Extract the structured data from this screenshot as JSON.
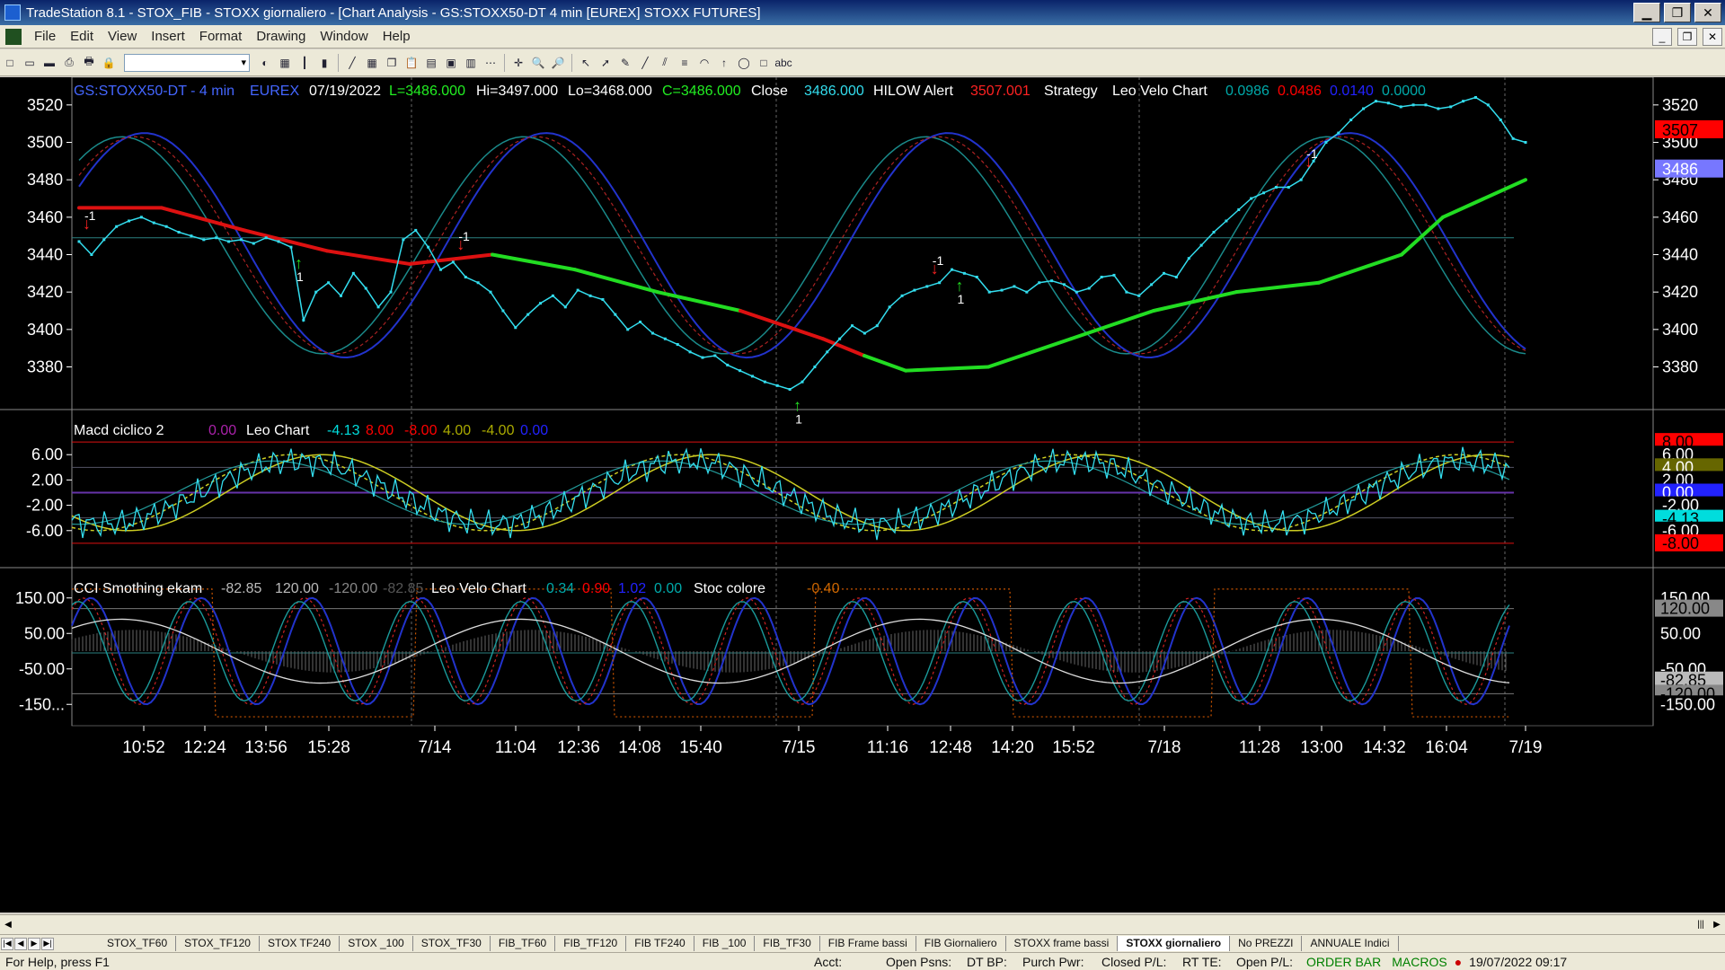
{
  "window": {
    "title": "TradeStation 8.1 - STOX_FIB - STOXX giornaliero - [Chart Analysis - GS:STOXX50-DT  4 min  [EUREX] STOXX FUTURES]",
    "minimize": "▁",
    "restore": "❐",
    "close": "✕"
  },
  "menu": {
    "items": [
      "File",
      "Edit",
      "View",
      "Insert",
      "Format",
      "Drawing",
      "Window",
      "Help"
    ],
    "child_min": "_",
    "child_restore": "❐",
    "child_close": "✕"
  },
  "toolbar": {
    "icons": [
      "new-icon",
      "open-icon",
      "save-icon",
      "print-icon",
      "preview-icon",
      "lock-icon",
      "color-icon",
      "chart-icon",
      "bar-icon",
      "candle-icon",
      "line-icon",
      "grid-icon",
      "copy-icon",
      "paste-icon",
      "table-icon",
      "window-icon",
      "tile-icon",
      "dots-icon",
      "cross-icon",
      "zoom-in-icon",
      "zoom-out-icon",
      "pointer-icon",
      "cursor-icon",
      "tools-icon",
      "trend-icon",
      "channel-icon",
      "fib-icon",
      "arc-icon",
      "arrow-up-icon",
      "ellipse-icon",
      "rectangle-icon",
      "text-icon"
    ],
    "glyphs": [
      "□",
      "▭",
      "▬",
      "⎙",
      "🖶",
      "🔒",
      "◐",
      "▦",
      "┃",
      "▮",
      "╱",
      "▦",
      "❐",
      "📋",
      "▤",
      "▣",
      "▥",
      "⋯",
      "✛",
      "🔍",
      "🔎",
      "↖",
      "➚",
      "✎",
      "╱",
      "⫽",
      "≡",
      "◠",
      "↑",
      "◯",
      "□",
      "abc"
    ],
    "symbol_combo": ""
  },
  "chart_data": [
    {
      "pane": "price",
      "type": "line",
      "header": {
        "symbol": "GS:STOXX50-DT - 4 min",
        "exchange": "EUREX",
        "date": "07/19/2022",
        "last": "L=3486.000",
        "high": "Hi=3497.000",
        "low": "Lo=3468.000",
        "close": "C=3486.000",
        "close_label": "Close",
        "close_value": "3486.000",
        "alert_label": "HILOW Alert",
        "alert_value": "3507.001",
        "strategy_label": "Strategy",
        "leo_label": "Leo Velo Chart",
        "leo_values": [
          "0.0986",
          "0.0486",
          "0.0140",
          "0.0000"
        ],
        "leo_colors": [
          "#00aaaa",
          "#ff0000",
          "#2222ff",
          "#00aaaa"
        ]
      },
      "y_ticks": [
        "3520",
        "3500",
        "3480",
        "3460",
        "3440",
        "3420",
        "3400",
        "3380"
      ],
      "ylim": [
        3362,
        3530
      ],
      "last_price_tag": "3486",
      "alert_price_tag": "3507",
      "x": [
        0,
        6,
        12,
        18,
        24,
        30,
        36,
        42,
        48,
        54,
        60,
        66,
        72,
        78,
        84,
        90,
        96,
        102,
        108,
        114,
        120,
        126,
        132,
        138,
        144,
        150,
        156,
        162,
        168,
        174,
        180,
        186,
        192,
        198,
        204,
        210,
        216,
        222,
        228,
        234,
        240,
        246,
        252,
        258,
        264,
        270,
        276,
        282,
        288,
        294,
        300,
        306,
        312,
        318,
        324,
        330,
        336,
        342,
        348,
        354,
        360,
        366,
        372,
        378,
        384,
        390,
        396,
        402,
        408,
        414,
        420,
        426,
        432,
        438,
        444,
        450,
        456,
        462,
        468,
        474,
        480,
        486,
        492,
        498,
        504,
        510,
        516,
        522,
        528,
        534,
        540,
        546,
        552,
        558,
        564,
        570,
        576,
        582,
        588,
        594,
        600,
        606,
        612,
        618,
        624,
        630,
        636,
        642,
        648,
        654,
        660,
        666,
        672,
        678,
        684,
        690,
        696
      ],
      "close_series": [
        3447,
        3440,
        3448,
        3455,
        3458,
        3460,
        3457,
        3455,
        3452,
        3450,
        3448,
        3449,
        3447,
        3448,
        3446,
        3449,
        3447,
        3444,
        3405,
        3420,
        3425,
        3418,
        3430,
        3422,
        3412,
        3420,
        3448,
        3453,
        3444,
        3432,
        3436,
        3428,
        3425,
        3420,
        3410,
        3401,
        3408,
        3414,
        3418,
        3412,
        3421,
        3418,
        3416,
        3408,
        3400,
        3404,
        3398,
        3395,
        3392,
        3388,
        3385,
        3386,
        3381,
        3378,
        3375,
        3372,
        3370,
        3368,
        3372,
        3380,
        3388,
        3395,
        3402,
        3398,
        3402,
        3412,
        3418,
        3421,
        3423,
        3425,
        3432,
        3430,
        3428,
        3420,
        3421,
        3423,
        3420,
        3425,
        3426,
        3424,
        3420,
        3422,
        3428,
        3429,
        3420,
        3418,
        3424,
        3430,
        3428,
        3438,
        3445,
        3452,
        3458,
        3464,
        3470,
        3473,
        3476,
        3476,
        3480,
        3490,
        3500,
        3505,
        3512,
        3518,
        3522,
        3521,
        3519,
        3520,
        3520,
        3518,
        3519,
        3522,
        3524,
        3520,
        3512,
        3502,
        3500
      ],
      "hilow_line": {
        "x": [
          0,
          40,
          80,
          120,
          160,
          200,
          240,
          280,
          320,
          360,
          380,
          400,
          440,
          480,
          520,
          560,
          600,
          640,
          660,
          700
        ],
        "y": [
          3465,
          3465,
          3453,
          3442,
          3435,
          3440,
          3432,
          3420,
          3410,
          3395,
          3386,
          3378,
          3380,
          3395,
          3410,
          3420,
          3425,
          3440,
          3460,
          3480
        ]
      },
      "signals": [
        {
          "label": "-1",
          "dir": "down"
        },
        {
          "label": "1",
          "dir": "up"
        },
        {
          "label": "-1",
          "dir": "down"
        },
        {
          "label": "1",
          "dir": "up"
        },
        {
          "label": "-1",
          "dir": "down"
        },
        {
          "label": "1",
          "dir": "up"
        },
        {
          "label": "-1",
          "dir": "down"
        }
      ]
    },
    {
      "pane": "macd",
      "type": "line",
      "header": {
        "title": "Macd ciclico 2",
        "v1": "0.00",
        "leo_label": "Leo Chart",
        "values": [
          "-4.13",
          "8.00",
          "-8.00",
          "4.00",
          "-4.00",
          "0.00"
        ],
        "colors": [
          "#00dddd",
          "#ff0000",
          "#ff0000",
          "#aaaa00",
          "#aaaa00",
          "#2222ff"
        ]
      },
      "y_ticks": [
        "6.00",
        "2.00",
        "-2.00",
        "-6.00"
      ],
      "ylim": [
        -11,
        11
      ],
      "tags": [
        {
          "text": "8.00",
          "bg": "#ff0000",
          "fg": "#000000"
        },
        {
          "text": "6.00",
          "bg": "#000000",
          "fg": "#ffffff"
        },
        {
          "text": "4.00",
          "bg": "#666600",
          "fg": "#ffffff"
        },
        {
          "text": "2.00",
          "bg": "#000000",
          "fg": "#ffffff"
        },
        {
          "text": "0.00",
          "bg": "#2222ff",
          "fg": "#ffffff"
        },
        {
          "text": "-2.00",
          "bg": "#000000",
          "fg": "#ffffff"
        },
        {
          "text": "-4.13",
          "bg": "#00dddd",
          "fg": "#000000"
        },
        {
          "text": "-6.00",
          "bg": "#000000",
          "fg": "#ffffff"
        },
        {
          "text": "-8.00",
          "bg": "#ff0000",
          "fg": "#000000"
        }
      ]
    },
    {
      "pane": "cci",
      "type": "line",
      "header": {
        "title": "CCI Smothing ekam",
        "values": [
          "-82.85",
          "120.00",
          "-120.00",
          "-82.85"
        ],
        "colors": [
          "#bbbbbb",
          "#bbbbbb",
          "#888888",
          "#555555"
        ],
        "leo_label": "Leo Velo Chart",
        "leo_values": [
          "0.34",
          "0.90",
          "1.02",
          "0.00"
        ],
        "leo_colors": [
          "#00aaaa",
          "#ff0000",
          "#2222ff",
          "#00aaaa"
        ],
        "stoc_label": "Stoc colore",
        "stoc_value": "-0.40",
        "stoc_color": "#cc6600"
      },
      "y_ticks": [
        "150.00",
        "50.00",
        "-50.00",
        "-150..."
      ],
      "ylim": [
        -200,
        200
      ],
      "tags": [
        {
          "text": "150.00",
          "bg": "#000000",
          "fg": "#ffffff"
        },
        {
          "text": "120.00",
          "bg": "#888888",
          "fg": "#000000"
        },
        {
          "text": "50.00",
          "bg": "#000000",
          "fg": "#ffffff"
        },
        {
          "text": "-50.00",
          "bg": "#000000",
          "fg": "#ffffff"
        },
        {
          "text": "-82.85",
          "bg": "#bbbbbb",
          "fg": "#000000"
        },
        {
          "text": "-120.00",
          "bg": "#888888",
          "fg": "#000000"
        },
        {
          "text": "-150.00",
          "bg": "#000000",
          "fg": "#ffffff"
        }
      ]
    }
  ],
  "x_axis": {
    "labels": [
      "10:52",
      "12:24",
      "13:56",
      "15:28",
      "7/14",
      "11:04",
      "12:36",
      "14:08",
      "15:40",
      "7/15",
      "11:16",
      "12:48",
      "14:20",
      "15:52",
      "7/18",
      "11:28",
      "13:00",
      "14:32",
      "16:04",
      "7/19"
    ]
  },
  "tabs": {
    "nav": [
      "|◀",
      "◀",
      "▶",
      "▶|"
    ],
    "items": [
      "STOX_TF60",
      "STOX_TF120",
      "STOX TF240",
      "STOX _100",
      "STOX_TF30",
      "FIB_TF60",
      "FIB_TF120",
      "FIB TF240",
      "FIB _100",
      "FIB_TF30",
      "FIB Frame bassi",
      "FIB Giornaliero",
      "STOXX frame bassi",
      "STOXX giornaliero",
      "No PREZZI",
      "ANNUALE Indici"
    ],
    "active": "STOXX giornaliero"
  },
  "status": {
    "help": "For Help, press F1",
    "acct": "Acct:",
    "open_psns": "Open Psns:",
    "dt_bp": "DT BP:",
    "purch_pwr": "Purch Pwr:",
    "closed_pl": "Closed P/L:",
    "rt_te": "RT TE:",
    "open_pl": "Open P/L:",
    "order_bar": "ORDER BAR",
    "macros": "MACROS",
    "datetime": "19/07/2022 09:17"
  }
}
